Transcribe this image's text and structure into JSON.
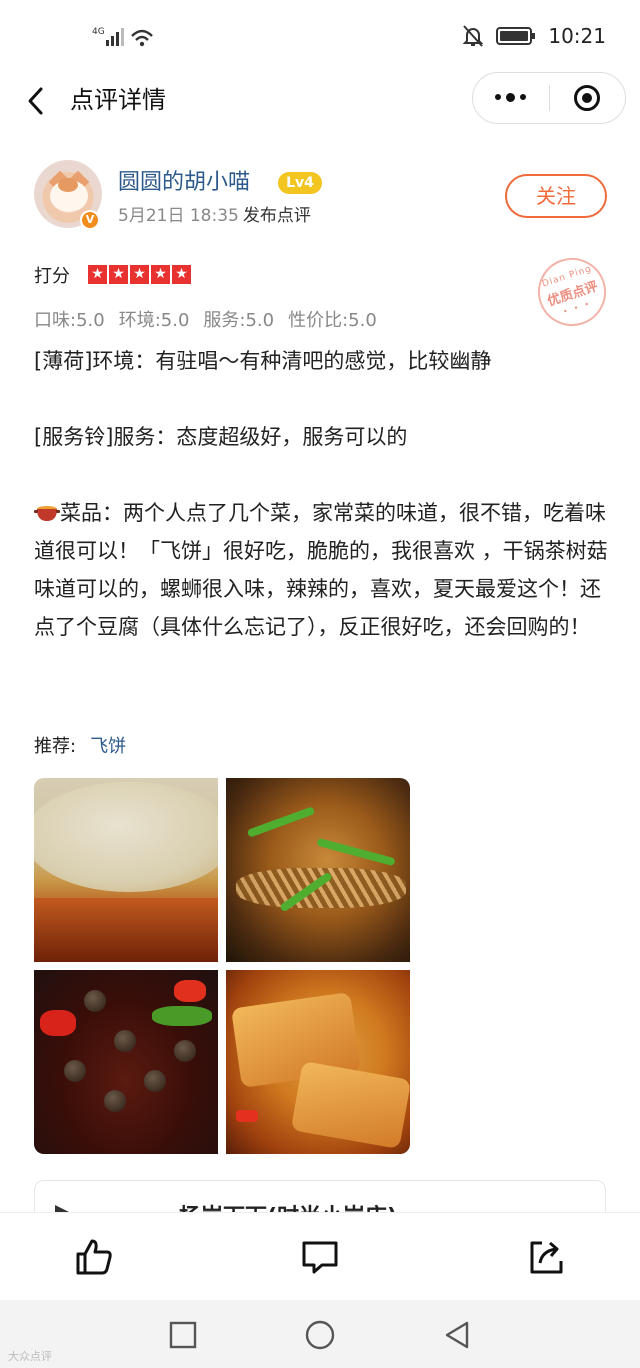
{
  "status_bar": {
    "network": "4G",
    "time": "10:21"
  },
  "nav": {
    "title": "点评详情"
  },
  "user": {
    "name": "圆圆的胡小喵",
    "level": "Lv4",
    "verified_mark": "V",
    "post_time": "5月21日 18:35",
    "post_action": "发布点评",
    "follow_label": "关注"
  },
  "rating": {
    "label": "打分",
    "stars": 5,
    "stamp_en": "Dian Ping",
    "stamp_cn": "优质点评",
    "sub_scores": [
      "口味:5.0",
      "环境:5.0",
      "服务:5.0",
      "性价比:5.0"
    ]
  },
  "review": {
    "line1": "[薄荷]环境：有驻唱～有种清吧的感觉，比较幽静",
    "line2": "[服务铃]服务：态度超级好，服务可以的",
    "line3": "菜品：两个人点了几个菜，家常菜的味道，很不错，吃着味道很可以！「飞饼」很好吃，脆脆的，我很喜欢 ，干锅茶树菇味道可以的，螺蛳很入味，辣辣的，喜欢，夏天最爱这个！还点了个豆腐（具体什么忘记了），反正很好吃，还会回购的！"
  },
  "recommend": {
    "label": "推荐:",
    "dish": "飞饼"
  },
  "shop": {
    "name": "杨岗下下(时尚小岗店)"
  },
  "icons": {
    "back": "chevron-left-icon",
    "more": "more-dots-icon",
    "close": "target-icon",
    "like": "thumbs-up-icon",
    "comment": "comment-icon",
    "share": "share-icon"
  },
  "colors": {
    "link_blue": "#2d5a8c",
    "accent_orange": "#f06a3a",
    "star_red": "#e8322f",
    "level_yellow": "#f2c521"
  },
  "watermark": "大众点评"
}
